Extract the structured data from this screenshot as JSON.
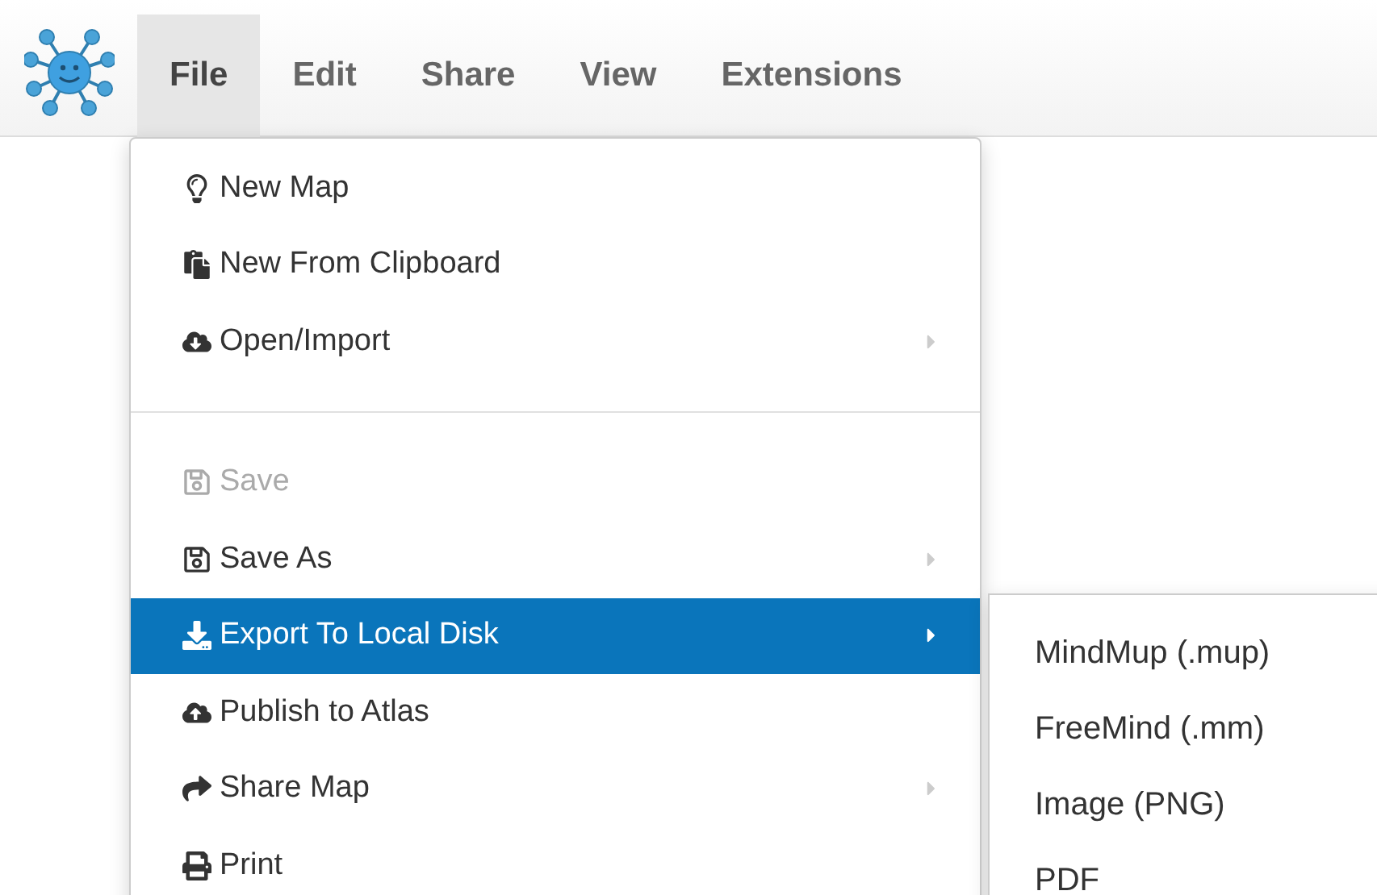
{
  "menubar": [
    {
      "label": "File",
      "selected": true
    },
    {
      "label": "Edit",
      "selected": false
    },
    {
      "label": "Share",
      "selected": false
    },
    {
      "label": "View",
      "selected": false
    },
    {
      "label": "Extensions",
      "selected": false
    }
  ],
  "file_menu": [
    {
      "kind": "item",
      "label": "New Map",
      "disabled": false,
      "submenu": false,
      "selected": false
    },
    {
      "kind": "item",
      "label": "New From Clipboard",
      "disabled": false,
      "submenu": false,
      "selected": false
    },
    {
      "kind": "item",
      "label": "Open/Import",
      "disabled": false,
      "submenu": true,
      "selected": false
    },
    {
      "kind": "divider"
    },
    {
      "kind": "item",
      "label": "Save",
      "disabled": true,
      "submenu": false,
      "selected": false
    },
    {
      "kind": "item",
      "label": "Save As",
      "disabled": false,
      "submenu": true,
      "selected": false
    },
    {
      "kind": "item",
      "label": "Export To Local Disk",
      "disabled": false,
      "submenu": true,
      "selected": true
    },
    {
      "kind": "item",
      "label": "Publish to Atlas",
      "disabled": false,
      "submenu": false,
      "selected": false
    },
    {
      "kind": "item",
      "label": "Share Map",
      "disabled": false,
      "submenu": true,
      "selected": false
    },
    {
      "kind": "item",
      "label": "Print",
      "disabled": false,
      "submenu": false,
      "selected": false
    }
  ],
  "export_submenu": [
    "MindMup (.mup)",
    "FreeMind (.mm)",
    "Image (PNG)",
    "PDF"
  ]
}
